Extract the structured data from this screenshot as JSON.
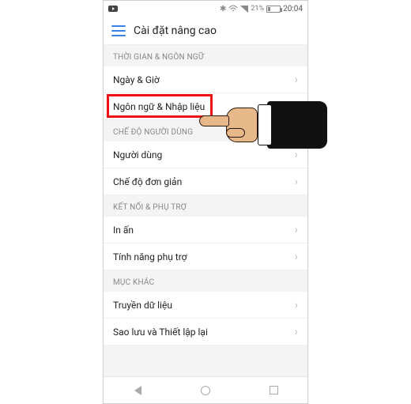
{
  "status": {
    "bluetooth": "✱",
    "battery_text": "21%",
    "time": "20:04"
  },
  "header": {
    "title": "Cài đặt nâng cao"
  },
  "sections": [
    {
      "title": "THỜI GIAN & NGÔN NGỮ",
      "items": [
        {
          "label": "Ngày & Giờ",
          "highlighted": false
        },
        {
          "label": "Ngôn ngữ & Nhập liệu",
          "highlighted": true
        }
      ]
    },
    {
      "title": "CHẾ ĐỘ NGƯỜI DÙNG",
      "items": [
        {
          "label": "Người dùng"
        },
        {
          "label": "Chế độ đơn giản"
        }
      ]
    },
    {
      "title": "KẾT NỐI & PHỤ TRỢ",
      "items": [
        {
          "label": "In ấn"
        },
        {
          "label": "Tính năng phụ trợ"
        }
      ]
    },
    {
      "title": "MỤC KHÁC",
      "items": [
        {
          "label": "Truyền dữ liệu"
        },
        {
          "label": "Sao lưu và Thiết lập lại"
        }
      ]
    }
  ]
}
